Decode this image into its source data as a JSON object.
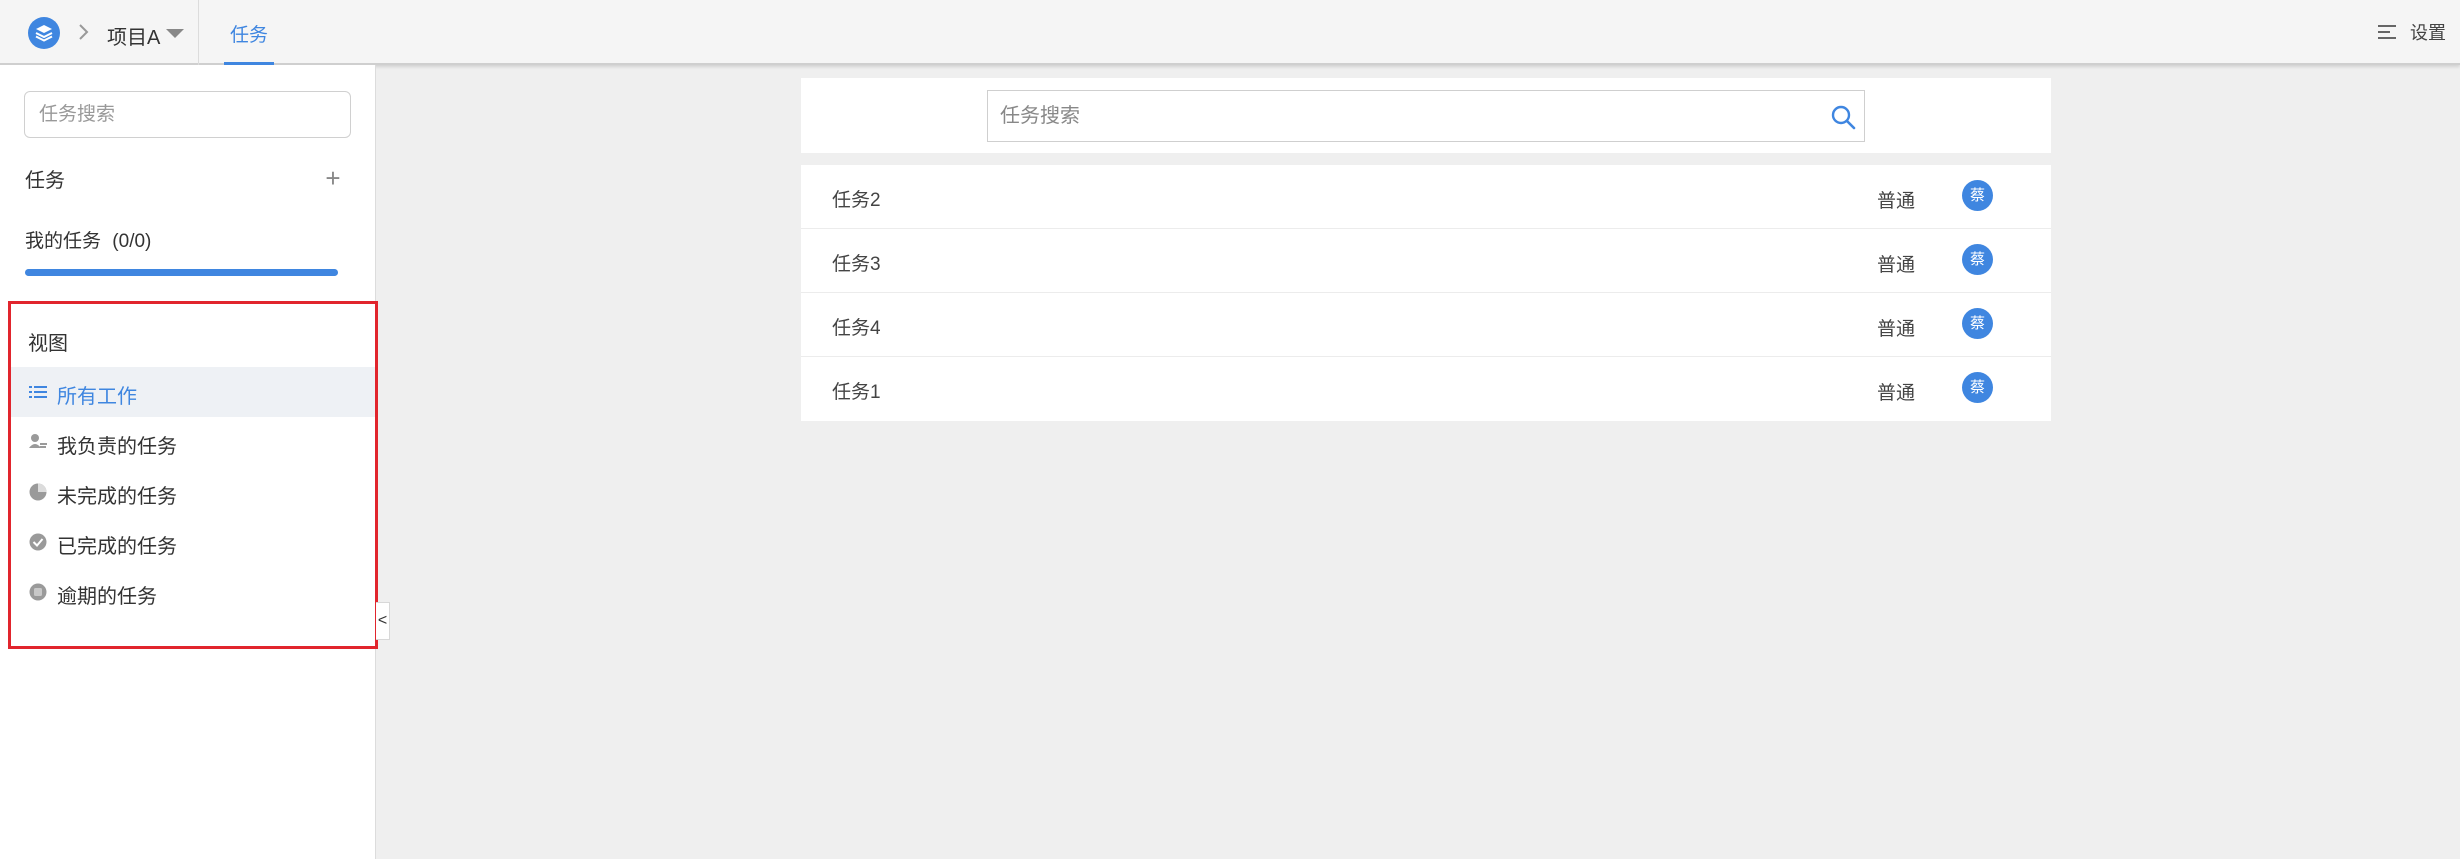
{
  "header": {
    "project_name": "项目A",
    "tabs": [
      {
        "label": "任务",
        "active": true
      }
    ],
    "settings_label": "设置"
  },
  "sidebar": {
    "search_placeholder": "任务搜索",
    "task_section_label": "任务",
    "my_tasks_label": "我的任务",
    "my_tasks_count": "(0/0)",
    "progress_fraction": 1.0,
    "views_title": "视图",
    "views": [
      {
        "label": "所有工作",
        "icon": "list-icon",
        "active": true
      },
      {
        "label": "我负责的任务",
        "icon": "person-assigned-icon",
        "active": false
      },
      {
        "label": "未完成的任务",
        "icon": "half-circle-icon",
        "active": false
      },
      {
        "label": "已完成的任务",
        "icon": "check-circle-icon",
        "active": false
      },
      {
        "label": "逾期的任务",
        "icon": "overdue-icon",
        "active": false
      }
    ],
    "collapse_label": "<"
  },
  "main": {
    "search_placeholder": "任务搜索",
    "tasks": [
      {
        "name": "任务2",
        "priority": "普通",
        "assignee": "蔡"
      },
      {
        "name": "任务3",
        "priority": "普通",
        "assignee": "蔡"
      },
      {
        "name": "任务4",
        "priority": "普通",
        "assignee": "蔡"
      },
      {
        "name": "任务1",
        "priority": "普通",
        "assignee": "蔡"
      }
    ]
  },
  "colors": {
    "accent": "#3f86e0",
    "highlight_border": "#e1252d",
    "background": "#efefef",
    "icon_gray": "#9a9a9a"
  }
}
